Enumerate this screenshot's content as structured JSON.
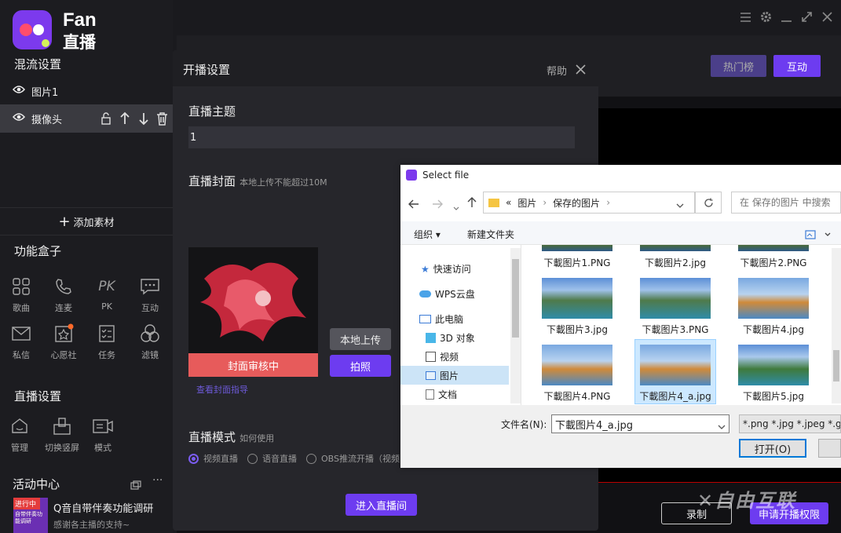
{
  "app": {
    "brand_top": "Fan",
    "brand_bottom": "直播"
  },
  "window_controls": [
    "menu-icon",
    "gear-icon",
    "minimize-icon",
    "maximize-icon",
    "close-icon"
  ],
  "sidebar": {
    "mix_title": "混流设置",
    "layers": [
      {
        "label": "图片1"
      },
      {
        "label": "摄像头"
      }
    ],
    "add_material": "添加素材",
    "func_title": "功能盒子",
    "tools": [
      {
        "label": "歌曲",
        "icon": "grid-icon"
      },
      {
        "label": "连麦",
        "icon": "phone-icon"
      },
      {
        "label": "PK",
        "icon": "pk-icon"
      },
      {
        "label": "互动",
        "icon": "chat-icon"
      },
      {
        "label": "私信",
        "icon": "mail-icon"
      },
      {
        "label": "心愿社",
        "icon": "wish-icon"
      },
      {
        "label": "任务",
        "icon": "task-icon"
      },
      {
        "label": "滤镜",
        "icon": "filter-icon"
      }
    ],
    "live_title": "直播设置",
    "live_tools": [
      {
        "label": "管理"
      },
      {
        "label": "切换竖屏"
      },
      {
        "label": "模式"
      }
    ],
    "activity_title": "活动中心",
    "activity": {
      "badge": "进行中",
      "thumb_text": "自带伴奏功能调研",
      "title": "Q音自带伴奏功能调研",
      "sub": "感谢各主播的支持~"
    }
  },
  "top_buttons": {
    "hot": "热门榜",
    "interact": "互动"
  },
  "bottom_buttons": {
    "record": "录制",
    "apply": "申请开播权限"
  },
  "watermark": "自由互联",
  "modal": {
    "title": "开播设置",
    "help": "帮助",
    "topic_label": "直播主题",
    "topic_value": "1",
    "cover_label": "直播封面",
    "cover_hint": "本地上传不能超过10M",
    "cover_status": "封面审核中",
    "cover_guide": "查看封面指导",
    "upload_btn": "本地上传",
    "photo_btn": "拍照",
    "mode_label": "直播模式",
    "mode_hint": "如何使用",
    "modes": [
      "视频直播",
      "语音直播",
      "OBS推流开播（视频"
    ],
    "enter_btn": "进入直播间"
  },
  "file_dialog": {
    "title": "Select file",
    "path": [
      "«",
      "图片",
      "保存的图片"
    ],
    "search_placeholder": "在 保存的图片 中搜索",
    "organize": "组织",
    "new_folder": "新建文件夹",
    "tree": [
      "快速访问",
      "WPS云盘",
      "此电脑",
      "3D 对象",
      "视频",
      "图片",
      "文档"
    ],
    "files": [
      "下載图片1.PNG",
      "下載图片2.jpg",
      "下載图片2.PNG",
      "下載图片3.jpg",
      "下載图片3.PNG",
      "下載图片4.jpg",
      "下載图片4.PNG",
      "下載图片4_a.jpg",
      "下載图片5.jpg"
    ],
    "filename_label": "文件名(N):",
    "filename_value": "下載图片4_a.jpg",
    "filter": "*.png *.jpg *.jpeg *.gif",
    "open_btn": "打开(O)"
  }
}
